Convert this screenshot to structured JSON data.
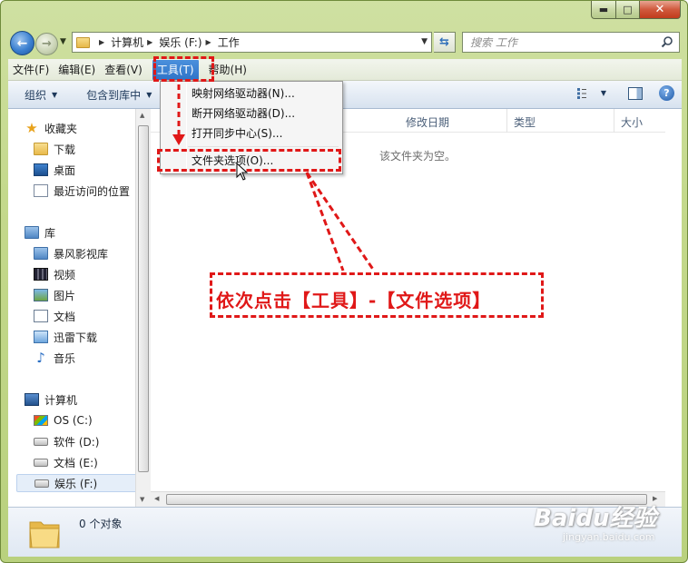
{
  "window": {
    "caption_min": "▬",
    "caption_max": "□",
    "caption_close": "✕"
  },
  "address_bar": {
    "crumbs": [
      "计算机",
      "娱乐 (F:)",
      "工作"
    ]
  },
  "search": {
    "placeholder": "搜索 工作"
  },
  "menubar": {
    "items": [
      "文件(F)",
      "编辑(E)",
      "查看(V)",
      "工具(T)",
      "帮助(H)"
    ],
    "active_index": 3
  },
  "toolbar": {
    "organize": "组织",
    "include_library": "包含到库中"
  },
  "tools_menu": {
    "items": [
      "映射网络驱动器(N)...",
      "断开网络驱动器(D)...",
      "打开同步中心(S)...",
      "文件夹选项(O)..."
    ]
  },
  "nav_tree": {
    "favorites": "收藏夹",
    "downloads": "下载",
    "desktop": "桌面",
    "recent": "最近访问的位置",
    "libraries": "库",
    "storm": "暴风影视库",
    "videos": "视频",
    "pictures": "图片",
    "documents": "文档",
    "thunder": "迅雷下载",
    "music": "音乐",
    "computer": "计算机",
    "drive_c": "OS (C:)",
    "drive_d": "软件 (D:)",
    "drive_e": "文档 (E:)",
    "drive_f": "娱乐 (F:)"
  },
  "columns": {
    "date": "修改日期",
    "type": "类型",
    "size": "大小"
  },
  "empty_message": "该文件夹为空。",
  "details": {
    "count": "0 个对象"
  },
  "annotation": {
    "text": "依次点击【工具】-【文件选项】",
    "color": "#e01818"
  },
  "watermark": {
    "brand": "Baidu经验",
    "url": "jingyan.baidu.com"
  }
}
